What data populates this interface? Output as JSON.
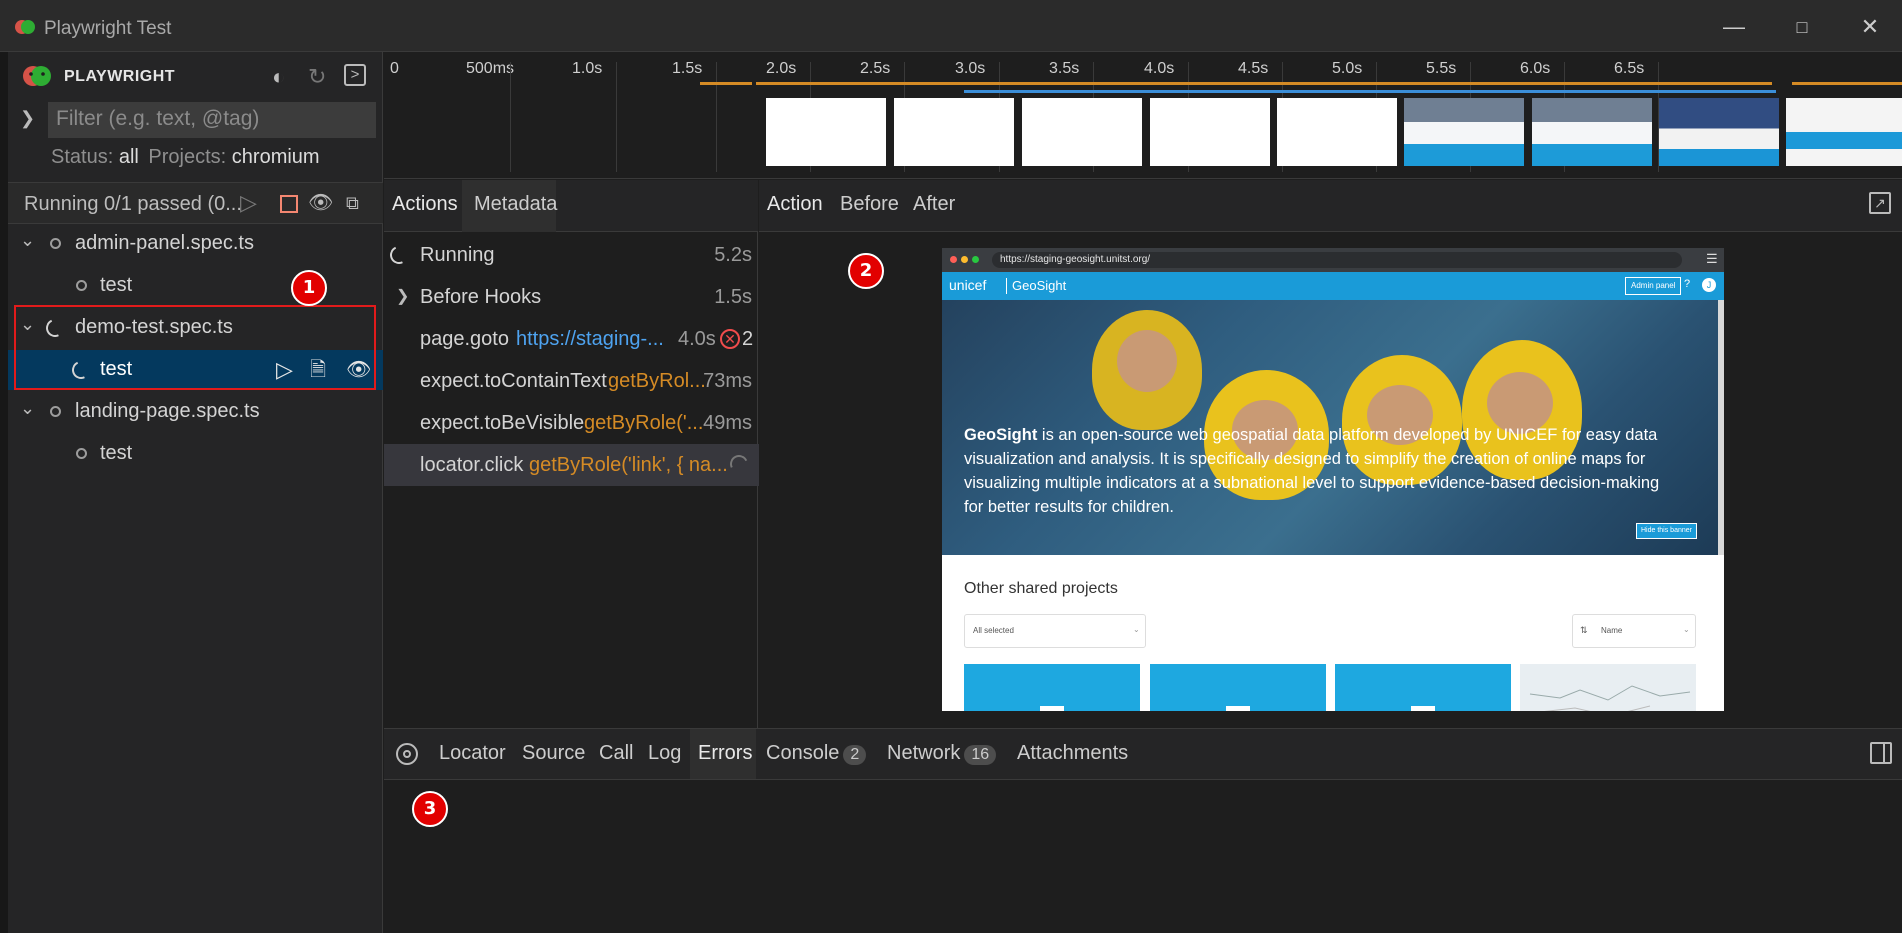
{
  "window": {
    "title": "Playwright Test"
  },
  "sidebar": {
    "header": "PLAYWRIGHT",
    "filter_placeholder": "Filter (e.g. text, @tag)",
    "status_label": "Status:",
    "status_value": "all",
    "projects_label": "Projects:",
    "projects_value": "chromium",
    "running_text": "Running 0/1 passed (0...",
    "tree": [
      {
        "label": "admin-panel.spec.ts",
        "child": "test"
      },
      {
        "label": "demo-test.spec.ts",
        "child": "test"
      },
      {
        "label": "landing-page.spec.ts",
        "child": "test"
      }
    ]
  },
  "timeline": {
    "ticks": [
      "0",
      "500ms",
      "1.0s",
      "1.5s",
      "2.0s",
      "2.5s",
      "3.0s",
      "3.5s",
      "4.0s",
      "4.5s",
      "5.0s",
      "5.5s",
      "6.0s",
      "6.5s"
    ]
  },
  "actions_panel": {
    "tabs": [
      "Actions",
      "Metadata"
    ],
    "rows": [
      {
        "name": "Running",
        "arg": "",
        "duration": "5.2s"
      },
      {
        "name": "Before Hooks",
        "arg": "",
        "duration": "1.5s"
      },
      {
        "name": "page.goto",
        "arg": "https://staging-...",
        "duration": "4.0s",
        "errors": "2"
      },
      {
        "name": "expect.toContainText",
        "arg": "getByRol...",
        "duration": "73ms"
      },
      {
        "name": "expect.toBeVisible",
        "arg": "getByRole('...",
        "duration": "49ms"
      },
      {
        "name": "locator.click",
        "arg": "getByRole('link', { na...",
        "duration": ""
      }
    ]
  },
  "snapshot_panel": {
    "tabs": [
      "Action",
      "Before",
      "After"
    ],
    "browser_url": "https://staging-geosight.unitst.org/",
    "brand": "unicef",
    "app_name": "GeoSight",
    "admin_button": "Admin panel",
    "hero_bold": "GeoSight",
    "hero_text": " is an open-source web geospatial data platform developed by UNICEF for easy data visualization and analysis. It is specifically designed to simplify the creation of online maps for visualizing multiple indicators at a subnational level to support evidence-based decision-making for better results for children.",
    "hide_banner": "Hide this banner",
    "section_title": "Other shared projects",
    "select_value": "All selected",
    "sort_value": "Name"
  },
  "bottom_tabs": [
    {
      "label": "Locator"
    },
    {
      "label": "Source"
    },
    {
      "label": "Call"
    },
    {
      "label": "Log"
    },
    {
      "label": "Errors"
    },
    {
      "label": "Console",
      "count": "2"
    },
    {
      "label": "Network",
      "count": "16"
    },
    {
      "label": "Attachments"
    }
  ],
  "annotations": [
    "1",
    "2",
    "3"
  ],
  "colors": {
    "accent": "#e21b1b",
    "selection": "#04395e",
    "timeline_orange": "#d58b25",
    "timeline_blue": "#3b8ed8"
  }
}
